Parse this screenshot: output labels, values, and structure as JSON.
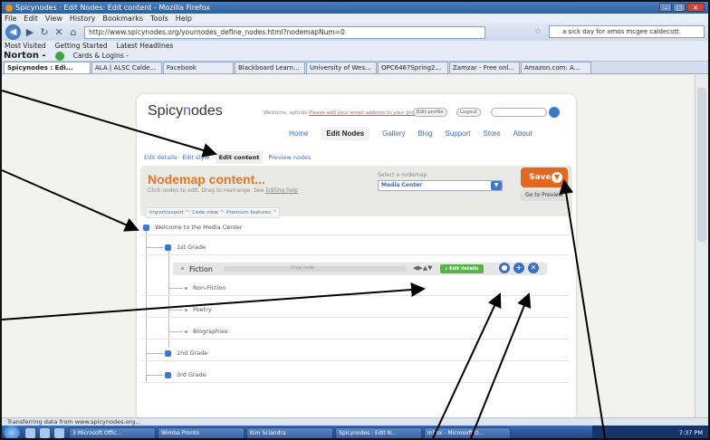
{
  "browser": {
    "title": "Spicynodes : Edit Nodes: Edit content - Mozilla Firefox",
    "menu": [
      "File",
      "Edit",
      "View",
      "History",
      "Bookmarks",
      "Tools",
      "Help"
    ],
    "url": "http://www.spicynodes.org/yournodes_define_nodes.html?nodemapNum=0",
    "search_value": "a sick day for amos mcgee caldecott",
    "bookmarks": [
      "Most Visited",
      "Getting Started",
      "Latest Headlines"
    ],
    "norton_label": "Norton -",
    "cards_label": "Cards & Logins -",
    "tabs": [
      {
        "label": "Spicynodes : Edi...",
        "active": true
      },
      {
        "label": "ALA | ALSC Calde..."
      },
      {
        "label": "Facebook"
      },
      {
        "label": "Blackboard Learn..."
      },
      {
        "label": "University of Wes..."
      },
      {
        "label": "OPC6467Spring2..."
      },
      {
        "label": "Zamzar - Free onl..."
      },
      {
        "label": "Amazon.com: A..."
      }
    ],
    "status": "Transferring data from www.spicynodes.org..."
  },
  "site": {
    "logo_prefix": "Spicy",
    "logo_n": "n",
    "logo_suffix": "odes",
    "welcome": "Welcome, spfoids",
    "welcome_link": "Please add your email address to your profile",
    "edit_profile": "Edit profile",
    "logout": "Logout",
    "nav": [
      "Home",
      "Edit Nodes",
      "Gallery",
      "Blog",
      "Support",
      "Store",
      "About"
    ],
    "subnav": [
      "Edit details",
      "Edit style",
      "Edit content",
      "Preview nodes"
    ],
    "panel_title": "Nodemap content...",
    "panel_sub": "Click nodes to edit. Drag to rearrange. See",
    "panel_sub_link": "Editing help",
    "select_label": "Select a nodemap:",
    "select_value": "Media Center",
    "save_label": "Save",
    "goto_label": "Go to Preview",
    "tools": [
      "Import/export ^",
      "Code view ^",
      "Premium features ^"
    ],
    "tree": {
      "root": "Welcome to the Media Center",
      "grade1": "1st Grade",
      "children": [
        "Fiction",
        "Non-Fiction",
        "Poetry",
        "Biographies"
      ],
      "grade2": "2nd Grade",
      "grade3": "3rd Grade"
    },
    "drag_node": "Drag node",
    "edit_details_btn": "▸ Edit details"
  },
  "taskbar": {
    "items": [
      "3 Microsoft Offic...",
      "Wimba Pronto",
      "Kim Sciandra",
      "Spicynodes : Edit N...",
      "Inbox - Microsoft O..."
    ],
    "clock": "7:37 PM"
  }
}
